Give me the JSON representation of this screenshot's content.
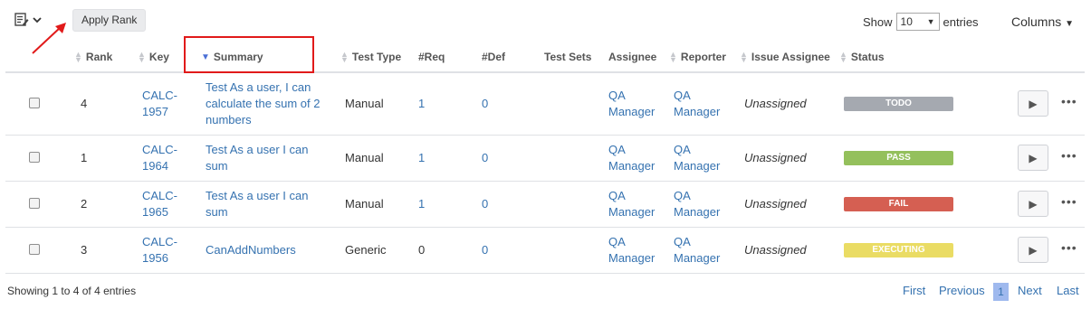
{
  "toolbar": {
    "menu_icon": "edit-list-icon",
    "apply_rank_label": "Apply Rank",
    "show_label": "Show",
    "entries_value": "10",
    "entries_label": "entries",
    "columns_label": "Columns"
  },
  "headers": {
    "rank": "Rank",
    "key": "Key",
    "summary": "Summary",
    "test_type": "Test Type",
    "req": "#Req",
    "def": "#Def",
    "test_sets": "Test Sets",
    "assignee": "Assignee",
    "reporter": "Reporter",
    "issue_assignee": "Issue Assignee",
    "status": "Status"
  },
  "rows": [
    {
      "rank": "4",
      "key": [
        "CALC-",
        "1957"
      ],
      "summary": [
        "Test As a user, I can",
        "calculate the sum of 2",
        "numbers"
      ],
      "test_type": "Manual",
      "req": "1",
      "def": "0",
      "assignee": [
        "QA",
        "Manager"
      ],
      "reporter": [
        "QA",
        "Manager"
      ],
      "issue_assignee": "Unassigned",
      "status": "TODO",
      "status_color": "#a5a9b0"
    },
    {
      "rank": "1",
      "key": [
        "CALC-",
        "1964"
      ],
      "summary": [
        "Test As a user I can",
        "sum"
      ],
      "test_type": "Manual",
      "req": "1",
      "def": "0",
      "assignee": [
        "QA",
        "Manager"
      ],
      "reporter": [
        "QA",
        "Manager"
      ],
      "issue_assignee": "Unassigned",
      "status": "PASS",
      "status_color": "#94c05c"
    },
    {
      "rank": "2",
      "key": [
        "CALC-",
        "1965"
      ],
      "summary": [
        "Test As a user I can",
        "sum"
      ],
      "test_type": "Manual",
      "req": "1",
      "def": "0",
      "assignee": [
        "QA",
        "Manager"
      ],
      "reporter": [
        "QA",
        "Manager"
      ],
      "issue_assignee": "Unassigned",
      "status": "FAIL",
      "status_color": "#d55f52"
    },
    {
      "rank": "3",
      "key": [
        "CALC-",
        "1956"
      ],
      "summary": [
        "CanAddNumbers"
      ],
      "test_type": "Generic",
      "req": "0",
      "def": "0",
      "assignee": [
        "QA",
        "Manager"
      ],
      "reporter": [
        "QA",
        "Manager"
      ],
      "issue_assignee": "Unassigned",
      "status": "EXECUTING",
      "status_color": "#eadc64"
    }
  ],
  "footer": {
    "info": "Showing 1 to 4 of 4 entries",
    "first": "First",
    "previous": "Previous",
    "current_page": "1",
    "next": "Next",
    "last": "Last"
  },
  "colors": {
    "accent_link": "#3572b0",
    "highlight_box": "#e11a1a"
  }
}
